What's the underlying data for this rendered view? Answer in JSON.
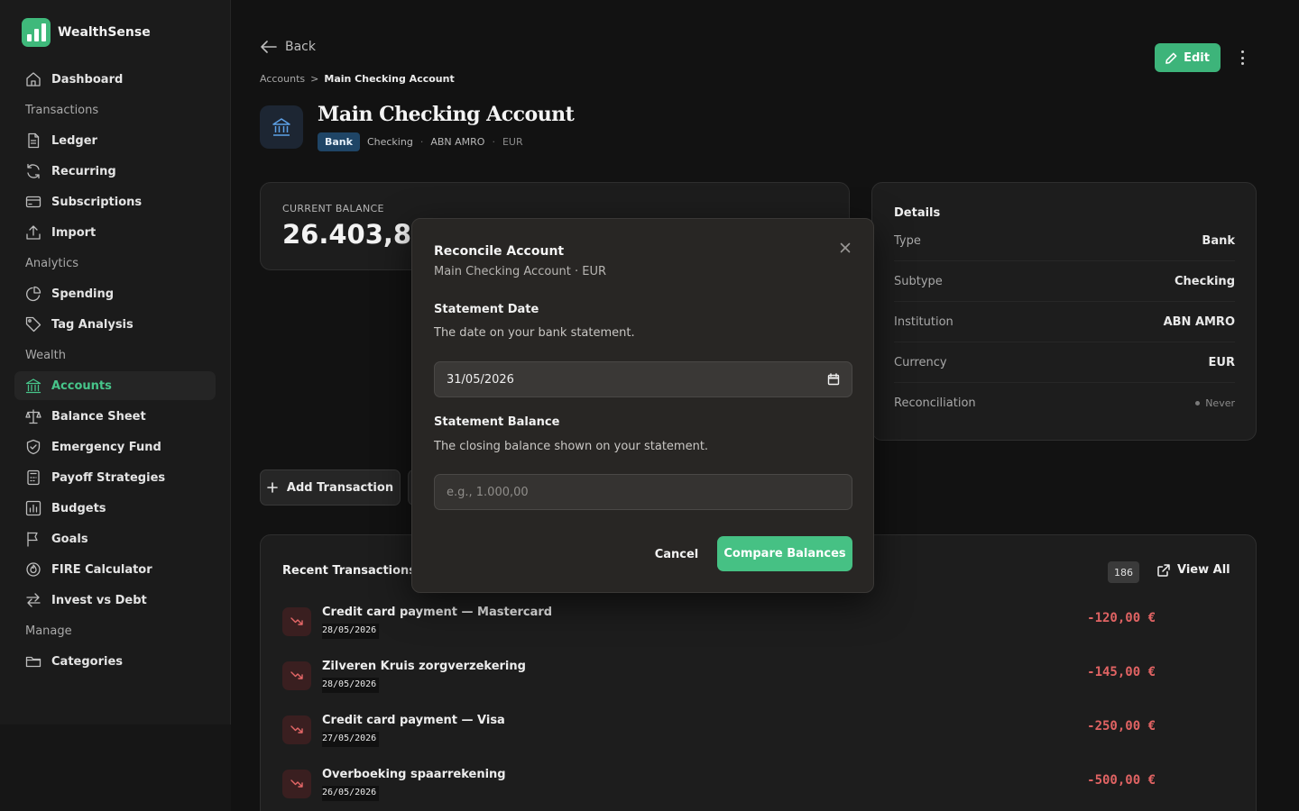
{
  "app": {
    "name": "WealthSense"
  },
  "sidebar": {
    "items": [
      {
        "type": "item",
        "label": "Dashboard",
        "icon": "home-icon"
      },
      {
        "type": "section",
        "label": "Transactions"
      },
      {
        "type": "item",
        "label": "Ledger",
        "icon": "document-icon"
      },
      {
        "type": "item",
        "label": "Recurring",
        "icon": "refresh-icon"
      },
      {
        "type": "item",
        "label": "Subscriptions",
        "icon": "credit-card-icon"
      },
      {
        "type": "item",
        "label": "Import",
        "icon": "upload-icon"
      },
      {
        "type": "section",
        "label": "Analytics"
      },
      {
        "type": "item",
        "label": "Spending",
        "icon": "pie-chart-icon"
      },
      {
        "type": "item",
        "label": "Tag Analysis",
        "icon": "tag-icon"
      },
      {
        "type": "section",
        "label": "Wealth"
      },
      {
        "type": "item",
        "label": "Accounts",
        "icon": "bank-icon",
        "active": true
      },
      {
        "type": "item",
        "label": "Balance Sheet",
        "icon": "scale-icon"
      },
      {
        "type": "item",
        "label": "Emergency Fund",
        "icon": "shield-icon"
      },
      {
        "type": "item",
        "label": "Payoff Strategies",
        "icon": "calculator-icon"
      },
      {
        "type": "item",
        "label": "Budgets",
        "icon": "bar-chart-icon"
      },
      {
        "type": "item",
        "label": "Goals",
        "icon": "flag-icon"
      },
      {
        "type": "item",
        "label": "FIRE Calculator",
        "icon": "flame-icon"
      },
      {
        "type": "item",
        "label": "Invest vs Debt",
        "icon": "arrows-swap-icon"
      },
      {
        "type": "section",
        "label": "Manage"
      },
      {
        "type": "item",
        "label": "Categories",
        "icon": "folder-icon"
      }
    ]
  },
  "header": {
    "back_label": "Back",
    "breadcrumb": {
      "parent": "Accounts",
      "separator": ">",
      "current": "Main Checking Account"
    },
    "edit_label": "Edit"
  },
  "account": {
    "name": "Main Checking Account",
    "type_badge": "Bank",
    "subtype": "Checking",
    "institution": "ABN AMRO",
    "currency": "EUR",
    "sep": "·"
  },
  "balance": {
    "label": "CURRENT BALANCE",
    "value": "26.403,84"
  },
  "details": {
    "title": "Details",
    "rows": [
      {
        "key": "Type",
        "value": "Bank"
      },
      {
        "key": "Subtype",
        "value": "Checking"
      },
      {
        "key": "Institution",
        "value": "ABN AMRO"
      },
      {
        "key": "Currency",
        "value": "EUR"
      },
      {
        "key": "Reconciliation",
        "value": "Never"
      }
    ]
  },
  "actions": {
    "add_transaction": "Add Transaction"
  },
  "recent": {
    "title": "Recent Transactions",
    "count": "186",
    "view_all": "View All",
    "transactions": [
      {
        "name": "Credit card payment — Mastercard",
        "date": "28/05/2026",
        "amount": "-120,00 €"
      },
      {
        "name": "Zilveren Kruis zorgverzekering",
        "date": "28/05/2026",
        "amount": "-145,00 €"
      },
      {
        "name": "Credit card payment — Visa",
        "date": "27/05/2026",
        "amount": "-250,00 €"
      },
      {
        "name": "Overboeking spaarrekening",
        "date": "26/05/2026",
        "amount": "-500,00 €"
      }
    ]
  },
  "modal": {
    "title": "Reconcile Account",
    "subtitle": "Main Checking Account · EUR",
    "date_label": "Statement Date",
    "date_help": "The date on your bank statement.",
    "date_value": "31/05/2026",
    "balance_label": "Statement Balance",
    "balance_help": "The closing balance shown on your statement.",
    "balance_placeholder": "e.g., 1.000,00",
    "cancel_label": "Cancel",
    "compare_label": "Compare Balances"
  },
  "colors": {
    "accent": "#3db47a",
    "negative": "#e06363",
    "bank_badge": "#1f4566"
  }
}
